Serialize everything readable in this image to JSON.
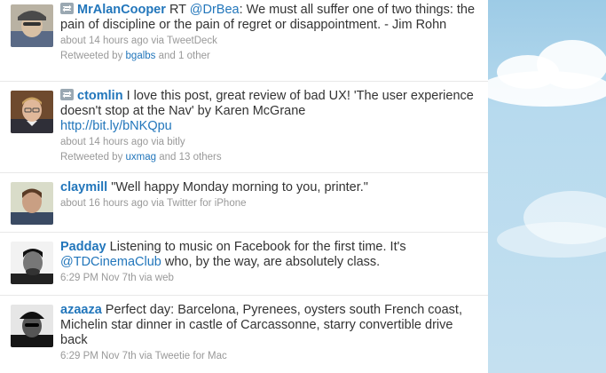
{
  "colors": {
    "link": "#2276bb",
    "text": "#333333",
    "meta": "#999999",
    "background": "#c0deed"
  },
  "tweets": [
    {
      "retweet_icon": "retweet-icon",
      "user": "MrAlanCooper",
      "text_a": "RT ",
      "mention": "@DrBea",
      "text_b": ": We must all suffer one of two things: the pain of discipline or the pain of regret or disappointment. - Jim Rohn",
      "time": "about 14 hours ago",
      "via_label": "via",
      "source": "TweetDeck",
      "retweeted_by": "Retweeted by",
      "retweeter": "bgalbs",
      "others": "and 1 other"
    },
    {
      "retweet_icon": "retweet-icon",
      "user": "ctomlin",
      "text": "I love this post, great review of bad UX! 'The user experience doesn't stop at the Nav' by Karen McGrane",
      "url": "http://bit.ly/bNKQpu",
      "time": "about 14 hours ago",
      "via_label": "via",
      "source": "bitly",
      "retweeted_by": "Retweeted by",
      "retweeter": "uxmag",
      "others": "and 13 others"
    },
    {
      "user": "claymill",
      "text": "\"Well happy Monday morning to you, printer.\"",
      "time": "about 16 hours ago",
      "via_label": "via",
      "source": "Twitter for iPhone"
    },
    {
      "user": "Padday",
      "text_a": "Listening to music on Facebook for the first time. It's ",
      "mention": "@TDCinemaClub",
      "text_b": " who, by the way, are absolutely class.",
      "time": "6:29 PM Nov 7th",
      "via_label": "via",
      "source": "web"
    },
    {
      "user": "azaaza",
      "text": "Perfect day: Barcelona, Pyrenees, oysters south French coast, Michelin star dinner in castle of Carcassonne, starry convertible drive back",
      "time": "6:29 PM Nov 7th",
      "via_label": "via",
      "source": "Tweetie for Mac"
    }
  ]
}
